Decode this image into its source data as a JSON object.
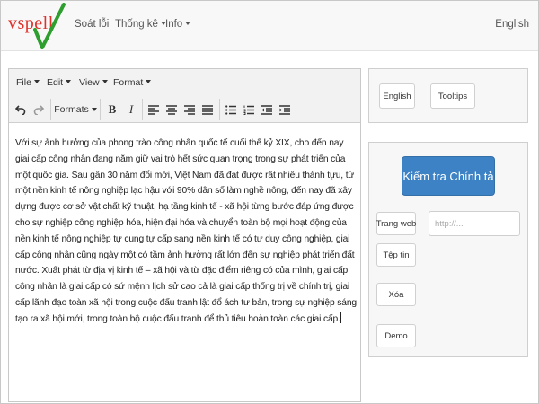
{
  "brand": {
    "name": "vspell"
  },
  "nav": {
    "items": [
      {
        "label": "Soát lỗi",
        "dropdown": false
      },
      {
        "label": "Thống kê",
        "dropdown": true
      },
      {
        "label": "Info",
        "dropdown": true
      }
    ],
    "language": "English"
  },
  "editor": {
    "menu": [
      "File",
      "Edit",
      "View",
      "Format"
    ],
    "toolbar": {
      "formats_label": "Formats",
      "bold_label": "B",
      "italic_label": "I"
    },
    "icons": {
      "undo": "undo-icon",
      "redo": "redo-icon",
      "align_left": "align-left-icon",
      "align_center": "align-center-icon",
      "align_right": "align-right-icon",
      "align_justify": "align-justify-icon",
      "bullet_list": "bullet-list-icon",
      "numbered_list": "numbered-list-icon",
      "outdent": "outdent-icon",
      "indent": "indent-icon"
    },
    "content": "Với sự ảnh hưởng của phong trào công nhân quốc tế cuối thế kỷ XIX, cho đến nay giai cấp công nhân đang nắm giữ vai trò hết sức quan trọng trong sự phát triển của một quốc gia. Sau gần 30 năm đổi mới, Việt Nam đã đạt được rất nhiều thành tựu, từ một nền kinh tế nông nghiệp lạc hậu với 90% dân số làm nghề nông, đến nay đã xây dựng được cơ sở vật chất kỹ thuật, hạ tầng kinh tế - xã hội từng bước đáp ứng được cho sự nghiệp công nghiệp hóa, hiện đại hóa và chuyển toàn bộ mọi hoạt động của nền kinh tế nông nghiệp tự cung tự cấp sang nền kinh tế có tư duy công nghiệp, giai cấp công nhân cũng ngày một có tầm ảnh hưởng rất lớn đến sự nghiệp phát triển đất nước. Xuất phát từ địa vị kinh tế – xã hội và  từ đặc điểm riêng có của mình, giai cấp công nhân là giai cấp có sứ mệnh lịch sử cao cả là  giai cấp thống trị về chính trị, giai cấp lãnh đạo toàn xã hội trong cuộc đấu tranh lật đổ ách tư bản, trong sự nghiệp sáng tạo ra xã hội mới, trong toàn bộ cuộc đấu tranh để thủ tiêu hoàn toàn các giai cấp."
  },
  "options_panel": {
    "english_label": "English",
    "tooltips_label": "Tooltips"
  },
  "check_panel": {
    "check_button": "Kiểm tra Chính tả",
    "webpage_button": "Trang web",
    "url_placeholder": "http://...",
    "file_button": "Tệp tin",
    "delete_button": "Xóa",
    "demo_button": "Demo"
  },
  "colors": {
    "primary": "#3d82c4",
    "logo_red": "#e0302a",
    "logo_green": "#2e9e2e"
  }
}
